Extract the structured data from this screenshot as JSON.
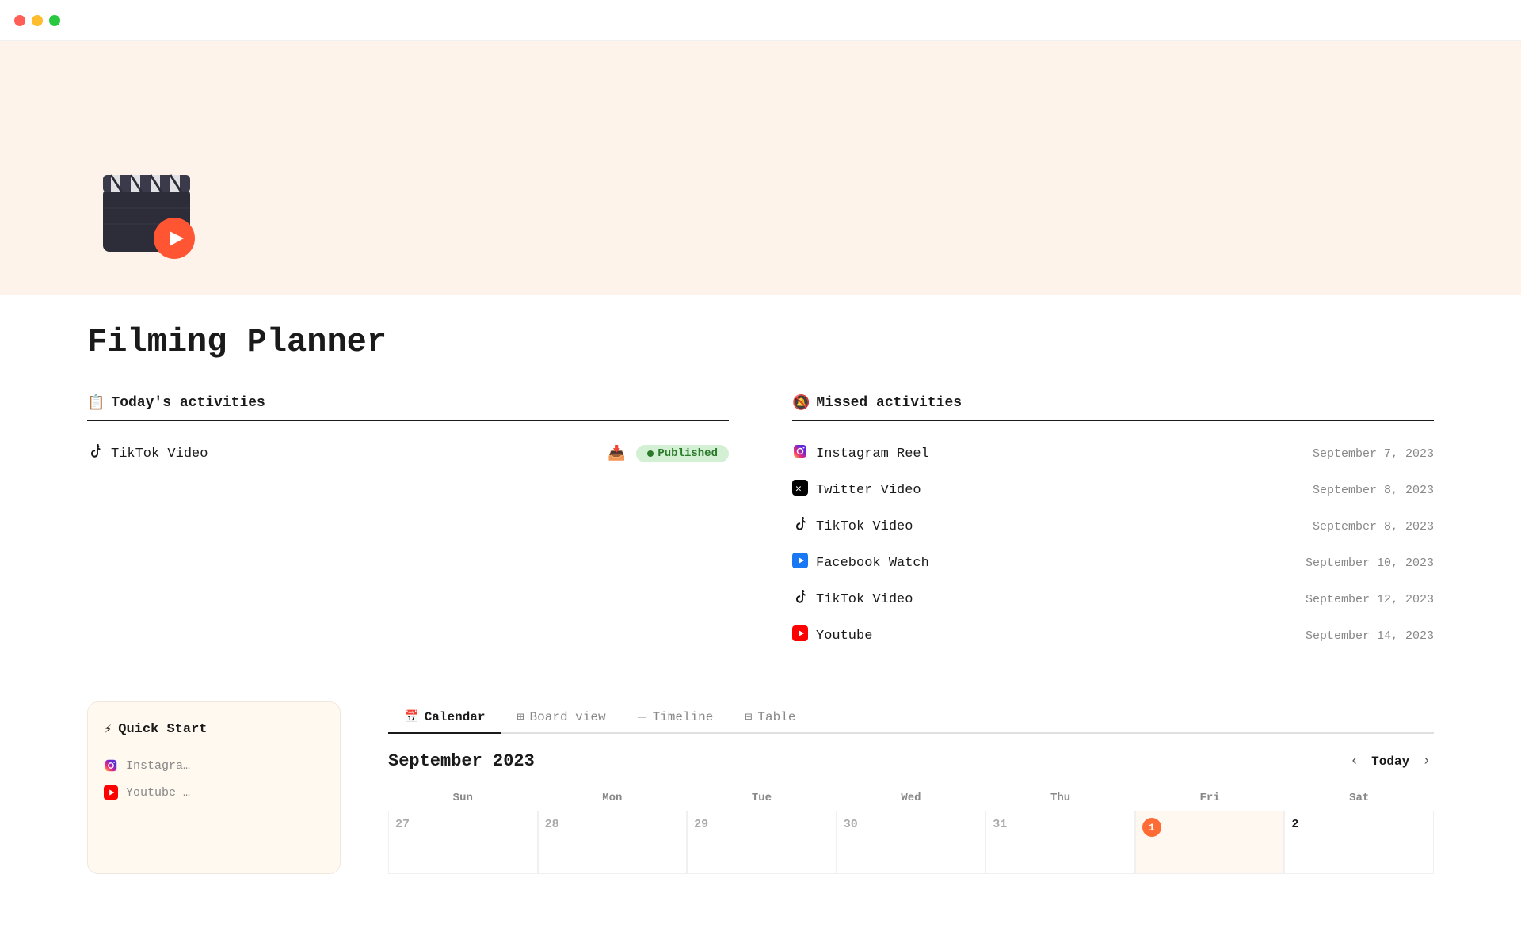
{
  "titlebar": {
    "traffic_lights": [
      "red",
      "yellow",
      "green"
    ]
  },
  "hero": {
    "icon": "🎬"
  },
  "page": {
    "title": "Filming Planner"
  },
  "today_activities": {
    "section_icon": "📋",
    "section_label": "Today's activities",
    "items": [
      {
        "platform_icon": "tiktok",
        "name": "TikTok Video",
        "status": "Published",
        "has_inbox": true
      }
    ]
  },
  "missed_activities": {
    "section_icon": "📵",
    "section_label": "Missed activities",
    "items": [
      {
        "platform": "instagram",
        "name": "Instagram Reel",
        "date": "September 7, 2023"
      },
      {
        "platform": "twitter",
        "name": "Twitter Video",
        "date": "September 8, 2023"
      },
      {
        "platform": "tiktok",
        "name": "TikTok Video",
        "date": "September 8, 2023"
      },
      {
        "platform": "facebook",
        "name": "Facebook Watch",
        "date": "September 10, 2023"
      },
      {
        "platform": "tiktok",
        "name": "TikTok Video",
        "date": "September 12, 2023"
      },
      {
        "platform": "youtube",
        "name": "Youtube",
        "date": "September 14, 2023"
      }
    ]
  },
  "quick_start": {
    "icon": "⚡",
    "title": "Quick Start",
    "items": [
      {
        "platform": "instagram",
        "name": "Instagra…"
      },
      {
        "platform": "youtube",
        "name": "Youtube …"
      }
    ]
  },
  "calendar": {
    "tabs": [
      {
        "icon": "📅",
        "label": "Calendar",
        "active": true
      },
      {
        "icon": "⊞",
        "label": "Board view",
        "active": false
      },
      {
        "icon": "⏤",
        "label": "Timeline",
        "active": false
      },
      {
        "icon": "⊟",
        "label": "Table",
        "active": false
      }
    ],
    "month_label": "September 2023",
    "today_label": "Today",
    "day_headers": [
      "Sun",
      "Mon",
      "Tue",
      "Wed",
      "Thu",
      "Fri",
      "Sat"
    ],
    "cells": [
      {
        "date": "27",
        "current": false
      },
      {
        "date": "28",
        "current": false
      },
      {
        "date": "29",
        "current": false
      },
      {
        "date": "30",
        "current": false
      },
      {
        "date": "31",
        "current": false
      },
      {
        "date": "Sep 1",
        "current": true,
        "highlight": true
      },
      {
        "date": "2",
        "current": true
      }
    ]
  },
  "platform_icons": {
    "tiktok": "♪",
    "instagram": "📷",
    "twitter": "✕",
    "facebook": "▶",
    "youtube": "▶"
  }
}
